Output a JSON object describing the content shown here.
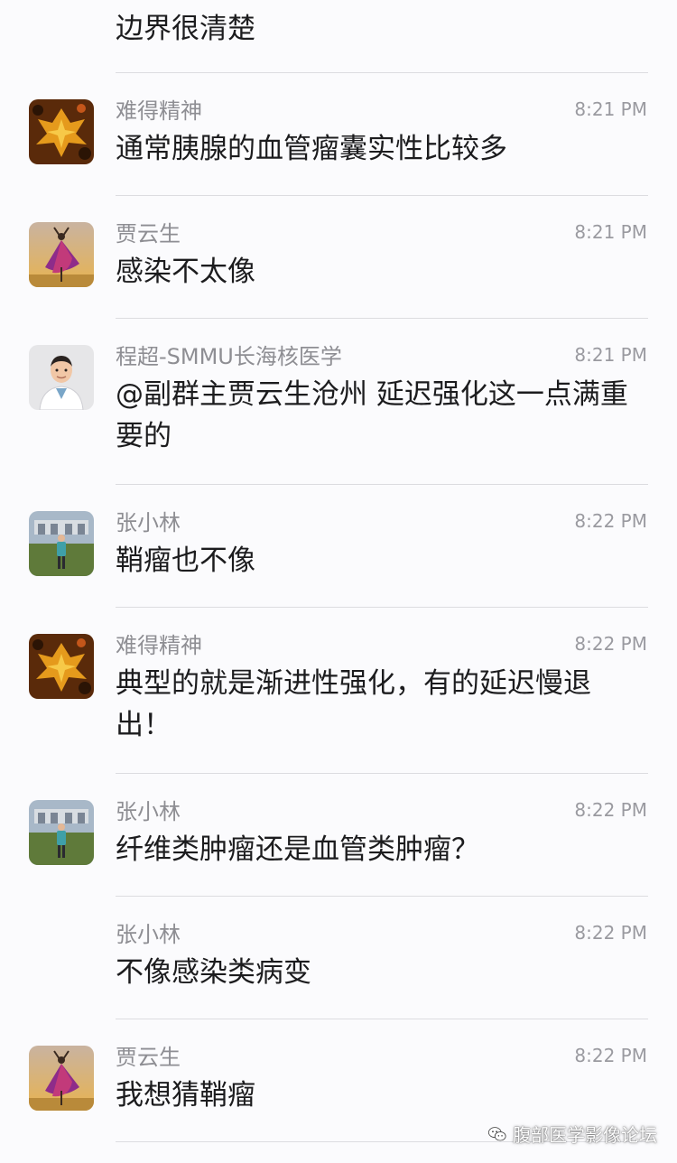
{
  "chat": {
    "top_fragment": "边界很清楚",
    "messages": [
      {
        "sender": "难得精神",
        "time": "8:21 PM",
        "text": "通常胰腺的血管瘤囊实性比较多",
        "avatar": "autumn-leaf-avatar"
      },
      {
        "sender": "贾云生",
        "time": "8:21 PM",
        "text": "感染不太像",
        "avatar": "dancer-avatar"
      },
      {
        "sender": "程超-SMMU长海核医学",
        "time": "8:21 PM",
        "text": "@副群主贾云生沧州 延迟强化这一点满重要的",
        "avatar": "doctor-avatar"
      },
      {
        "sender": "张小林",
        "time": "8:22 PM",
        "text": "鞘瘤也不像",
        "avatar": "outdoor-person-avatar"
      },
      {
        "sender": "难得精神",
        "time": "8:22 PM",
        "text": "典型的就是渐进性强化，有的延迟慢退出！",
        "avatar": "autumn-leaf-avatar"
      },
      {
        "sender": "张小林",
        "time": "8:22 PM",
        "text": "纤维类肿瘤还是血管类肿瘤？",
        "avatar": "outdoor-person-avatar"
      },
      {
        "sender": "张小林",
        "time": "8:22 PM",
        "text": "不像感染类病变",
        "avatar": ""
      },
      {
        "sender": "贾云生",
        "time": "8:22 PM",
        "text": "我想猜鞘瘤",
        "avatar": "dancer-avatar"
      }
    ]
  },
  "watermark": {
    "text": "腹部医学影像论坛",
    "icon": "wechat-logo-icon"
  }
}
